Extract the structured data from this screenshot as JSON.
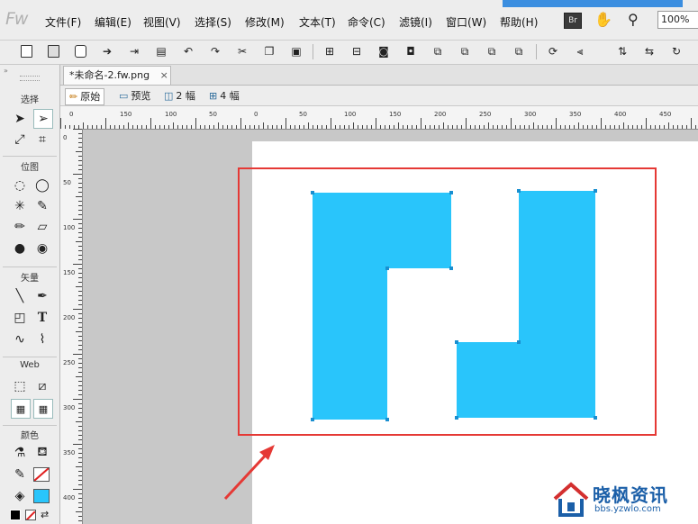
{
  "app": {
    "logo": "Fw"
  },
  "menu": [
    "文件(F)",
    "编辑(E)",
    "视图(V)",
    "选择(S)",
    "修改(M)",
    "文本(T)",
    "命令(C)",
    "滤镜(I)",
    "窗口(W)",
    "帮助(H)"
  ],
  "menubar_right": {
    "bridge_label": "Br",
    "zoom": "100%"
  },
  "document": {
    "tab_title": "*未命名-2.fw.png",
    "close_glyph": "×"
  },
  "view_modes": [
    "原始",
    "预览",
    "2 幅",
    "4 幅"
  ],
  "tools_panel": {
    "sections": [
      "选择",
      "位图",
      "矢量",
      "Web",
      "颜色"
    ],
    "fill_color": "#29c5fb"
  },
  "rulers": {
    "horizontal": [
      "0",
      "150",
      "100",
      "50",
      "0",
      "50",
      "100",
      "150",
      "200",
      "250",
      "300",
      "350",
      "400",
      "450"
    ],
    "vertical": [
      "0",
      "50",
      "100",
      "150",
      "200",
      "250",
      "300",
      "350",
      "400"
    ]
  },
  "canvas": {
    "shape_color": "#29c5fb",
    "annotation_color": "#e53935"
  },
  "watermark": {
    "text": "晓枫资讯",
    "url": "bbs.yzwlo.com"
  }
}
